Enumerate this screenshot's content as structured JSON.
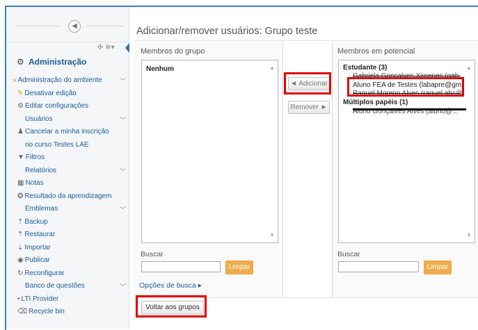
{
  "page_title": "Adicionar/remover usuários: Grupo teste",
  "sidebar": {
    "collapse_icon": "collapse-circle-icon",
    "block_controls": "✣ ✲▾",
    "admin_title": "Administração",
    "items": [
      {
        "label": "Administração do ambiente",
        "icon": "caret-icon",
        "chevron": true
      },
      {
        "label": "Desativar edição",
        "icon": "pencil-icon",
        "chevron": false
      },
      {
        "label": "Editar configurações",
        "icon": "gear-icon",
        "chevron": false
      },
      {
        "label": "Usuários",
        "icon": "",
        "chevron": true
      },
      {
        "label": "Cancelar a minha inscrição",
        "icon": "user-icon",
        "chevron": false
      },
      {
        "label": "no curso Testes LAE",
        "icon": "",
        "chevron": false
      },
      {
        "label": "Filtros",
        "icon": "filter-icon",
        "chevron": false
      },
      {
        "label": "Relatórios",
        "icon": "",
        "chevron": true
      },
      {
        "label": "Notas",
        "icon": "grid-icon",
        "chevron": false
      },
      {
        "label": "Resultado da aprendizagem",
        "icon": "award-icon",
        "chevron": false
      },
      {
        "label": "Emblemas",
        "icon": "",
        "chevron": true
      },
      {
        "label": "Backup",
        "icon": "upload-icon",
        "chevron": false
      },
      {
        "label": "Restaurar",
        "icon": "upload-icon",
        "chevron": false
      },
      {
        "label": "Importar",
        "icon": "download-icon",
        "chevron": false
      },
      {
        "label": "Publicar",
        "icon": "share-icon",
        "chevron": false
      },
      {
        "label": "Reconfigurar",
        "icon": "refresh-icon",
        "chevron": false
      },
      {
        "label": "Banco de questões",
        "icon": "",
        "chevron": true
      },
      {
        "label": "LTI Provider",
        "icon": "dot-icon",
        "chevron": false
      },
      {
        "label": "Recycle bin",
        "icon": "bin-icon",
        "chevron": false
      }
    ]
  },
  "members": {
    "label": "Membros do grupo",
    "options": [
      "Nenhum"
    ],
    "search_label": "Buscar",
    "search_value": "",
    "clear_label": "Limpar"
  },
  "actions": {
    "add_label": "◄ Adicionar",
    "remove_label": "Remover ►"
  },
  "potential": {
    "label": "Membros em potencial",
    "group1": "Estudante (3)",
    "user1": "Gabriela Gonçalves Ximenes (gab...",
    "user2": "Aluno FEA de Testes (labapre@gm",
    "user3": "Raquel Moreno Alves (raquel.abc@",
    "group2": "Múltiplos papéis (1)",
    "user4": "Aluno Gonçalves Alves (aluno@...",
    "search_label": "Buscar",
    "search_value": "",
    "clear_label": "Limpar"
  },
  "search_options": "Opções de busca ▸",
  "back_label": "Voltar aos grupos",
  "colors": {
    "accent": "#1c5a96",
    "highlight": "#e00000",
    "clear_button": "#f0ad4e"
  }
}
